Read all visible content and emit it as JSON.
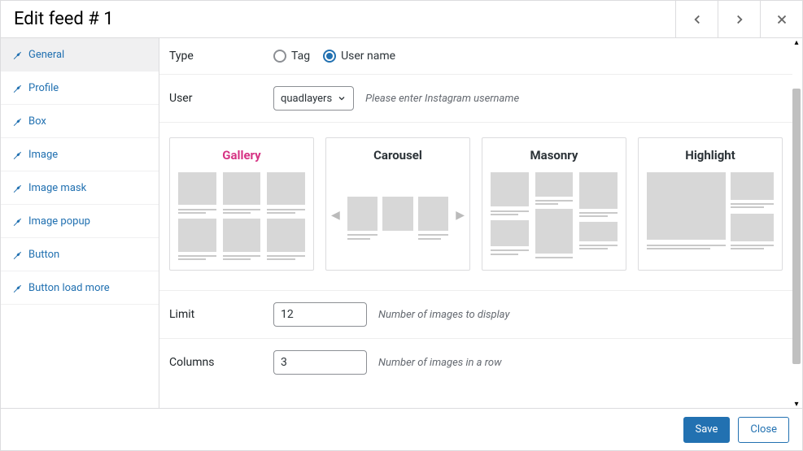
{
  "header": {
    "title": "Edit feed # 1"
  },
  "sidebar": {
    "items": [
      {
        "label": "General"
      },
      {
        "label": "Profile"
      },
      {
        "label": "Box"
      },
      {
        "label": "Image"
      },
      {
        "label": "Image mask"
      },
      {
        "label": "Image popup"
      },
      {
        "label": "Button"
      },
      {
        "label": "Button load more"
      }
    ]
  },
  "form": {
    "type": {
      "label": "Type",
      "options": {
        "tag": "Tag",
        "username": "User name"
      },
      "selected": "username"
    },
    "user": {
      "label": "User",
      "value": "quadlayers",
      "hint": "Please enter Instagram username"
    },
    "layouts": [
      {
        "key": "gallery",
        "label": "Gallery"
      },
      {
        "key": "carousel",
        "label": "Carousel"
      },
      {
        "key": "masonry",
        "label": "Masonry"
      },
      {
        "key": "highlight",
        "label": "Highlight"
      }
    ],
    "selected_layout": "gallery",
    "limit": {
      "label": "Limit",
      "value": "12",
      "hint": "Number of images to display"
    },
    "columns": {
      "label": "Columns",
      "value": "3",
      "hint": "Number of images in a row"
    }
  },
  "footer": {
    "save": "Save",
    "close": "Close"
  }
}
